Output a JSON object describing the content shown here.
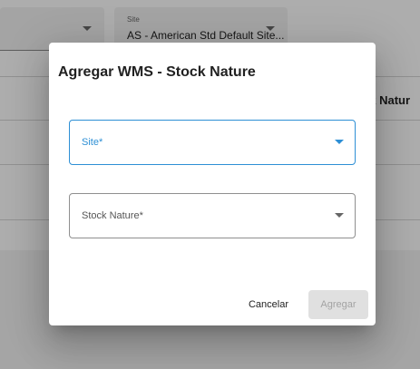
{
  "background": {
    "left_select": {
      "label": "",
      "value": ""
    },
    "site_select": {
      "label": "Site",
      "value": "AS - American Std Default Site..."
    },
    "table_header_fragment": "ck Natur"
  },
  "dialog": {
    "title": "Agregar WMS - Stock Nature",
    "site_field": {
      "label": "Site*",
      "state": "focused"
    },
    "stock_nature_field": {
      "label": "Stock Nature*"
    },
    "cancel_label": "Cancelar",
    "add_label": "Agregar"
  },
  "colors": {
    "accent": "#2d8fd5",
    "overlay": "rgba(0,0,0,0.32)",
    "disabled_bg": "#e0e0e0"
  }
}
